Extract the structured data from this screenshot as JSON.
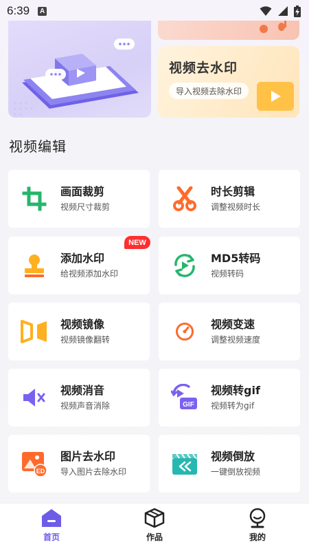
{
  "status_bar": {
    "time": "6:39",
    "notification_icon": "A"
  },
  "banners": {
    "watermark_title": "视频去水印",
    "watermark_subtitle": "导入视频去除水印"
  },
  "section": {
    "title": "视频编辑"
  },
  "tools": [
    {
      "title": "画面裁剪",
      "subtitle": "视频尺寸裁剪",
      "icon": "crop-icon"
    },
    {
      "title": "时长剪辑",
      "subtitle": "调整视频时长",
      "icon": "scissors-icon"
    },
    {
      "title": "添加水印",
      "subtitle": "给视频添加水印",
      "icon": "stamp-icon",
      "badge": "NEW"
    },
    {
      "title": "MD5转码",
      "subtitle": "视频转码",
      "icon": "refresh-play-icon"
    },
    {
      "title": "视频镜像",
      "subtitle": "视频镜像翻转",
      "icon": "mirror-icon"
    },
    {
      "title": "视频变速",
      "subtitle": "调整视频速度",
      "icon": "speedometer-icon"
    },
    {
      "title": "视频消音",
      "subtitle": "视频声音消除",
      "icon": "mute-icon"
    },
    {
      "title": "视频转gif",
      "subtitle": "视频转为gif",
      "icon": "gif-icon"
    },
    {
      "title": "图片去水印",
      "subtitle": "导入图片去除水印",
      "icon": "image-erase-icon"
    },
    {
      "title": "视频倒放",
      "subtitle": "一键倒放视频",
      "icon": "rewind-clapper-icon"
    }
  ],
  "bottom_nav": [
    {
      "label": "首页",
      "icon": "home-icon",
      "active": true
    },
    {
      "label": "作品",
      "icon": "box-icon",
      "active": false
    },
    {
      "label": "我的",
      "icon": "profile-icon",
      "active": false
    }
  ],
  "colors": {
    "accent": "#6d5ce8",
    "badge": "#ff2f2f",
    "orange": "#ff6a2b",
    "yellow": "#ffb020",
    "green": "#27b56b",
    "teal": "#26b8b0"
  }
}
